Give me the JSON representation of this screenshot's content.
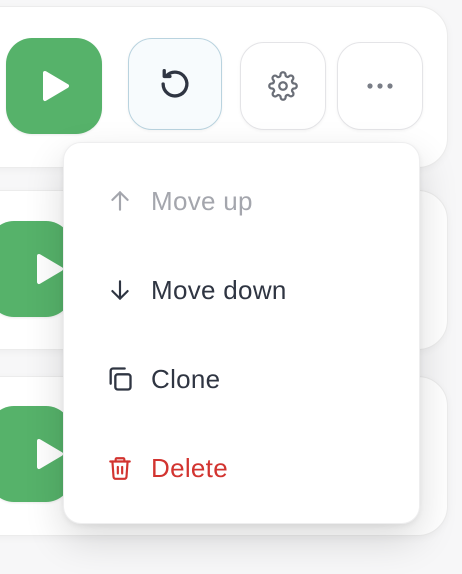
{
  "colors": {
    "play_green": "#56b26a",
    "text_dark": "#2f3542",
    "text_disabled": "#a4a6ad",
    "danger": "#d23430",
    "restart_border": "#b9d3df"
  },
  "toolbar": {
    "play_icon": "play-icon",
    "restart_icon": "restart-icon",
    "settings_icon": "gear-icon",
    "more_icon": "more-horizontal-icon"
  },
  "menu": {
    "items": [
      {
        "label": "Move up",
        "icon": "arrow-up-icon",
        "disabled": true
      },
      {
        "label": "Move down",
        "icon": "arrow-down-icon",
        "disabled": false
      },
      {
        "label": "Clone",
        "icon": "copy-icon",
        "disabled": false
      },
      {
        "label": "Delete",
        "icon": "trash-icon",
        "disabled": false,
        "danger": true
      }
    ]
  }
}
